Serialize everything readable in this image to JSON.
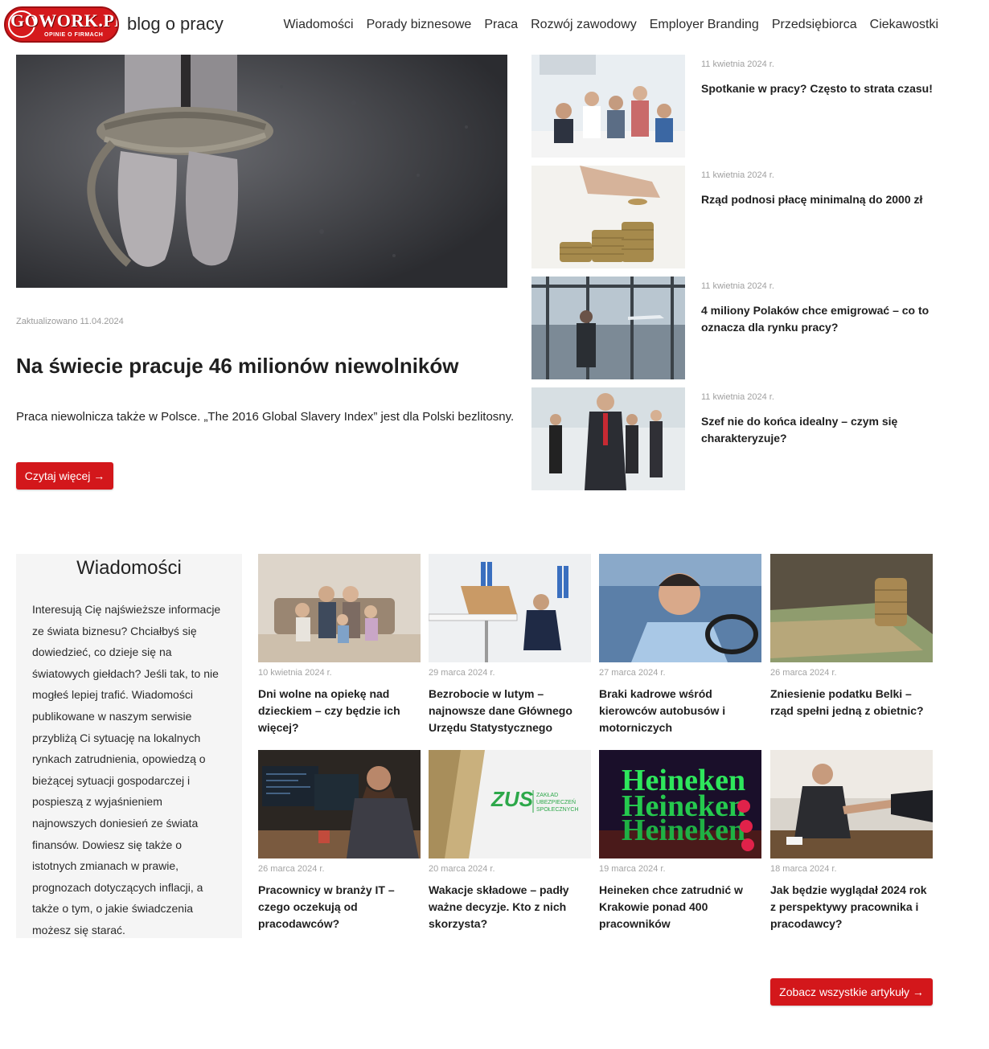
{
  "header": {
    "logo_text": "GOWORK.PL",
    "logo_sub": "OPINIE O FIRMACH",
    "brand": "blog o pracy",
    "nav": [
      "Wiadomości",
      "Porady biznesowe",
      "Praca",
      "Rozwój zawodowy",
      "Employer Branding",
      "Przedsiębiorca",
      "Ciekawostki"
    ]
  },
  "hero": {
    "updated": "Zaktualizowano 11.04.2024",
    "title": "Na świecie pracuje 46 milionów niewolników",
    "excerpt": "Praca niewolnicza także w Polsce. „The 2016 Global Slavery Index” jest dla Polski bezlitosny.",
    "button": "Czytaj więcej →"
  },
  "side_articles": [
    {
      "date": "11 kwietnia 2024 r.",
      "title": "Spotkanie w pracy? Często to strata czasu!"
    },
    {
      "date": "11 kwietnia 2024 r.",
      "title": "Rząd podnosi płacę minimalną do 2000 zł"
    },
    {
      "date": "11 kwietnia 2024 r.",
      "title": "4 miliony Polaków chce emigrować – co to oznacza dla rynku pracy?"
    },
    {
      "date": "11 kwietnia 2024 r.",
      "title": "Szef nie do końca idealny – czym się charakteryzuje?"
    }
  ],
  "section": {
    "title": "Wiadomości",
    "description": "Interesują Cię najświeższe informacje ze świata biznesu? Chciałbyś się dowiedzieć, co dzieje się na światowych giełdach? Jeśli tak, to nie mogłeś lepiej trafić. Wiadomości publikowane w naszym serwisie przybliżą Ci sytuację na lokalnych rynkach zatrudnienia, opowiedzą o bieżącej sytuacji gospodarczej i pospieszą z wyjaśnieniem najnowszych doniesień ze świata finansów. Dowiesz się także o istotnych zmianach w prawie, prognozach dotyczących inflacji, a także o tym, o jakie świadczenia możesz się starać."
  },
  "grid": [
    {
      "date": "10 kwietnia 2024 r.",
      "title": "Dni wolne na opiekę nad dzieckiem – czy będzie ich więcej?"
    },
    {
      "date": "29 marca 2024 r.",
      "title": "Bezrobocie w lutym – najnowsze dane Głównego Urzędu Statystycznego"
    },
    {
      "date": "27 marca 2024 r.",
      "title": "Braki kadrowe wśród kierowców autobusów i motorniczych"
    },
    {
      "date": "26 marca 2024 r.",
      "title": "Zniesienie podatku Belki – rząd spełni jedną z obietnic?"
    },
    {
      "date": "26 marca 2024 r.",
      "title": "Pracownicy w branży IT – czego oczekują od pracodawców?"
    },
    {
      "date": "20 marca 2024 r.",
      "title": "Wakacje składowe – padły ważne decyzje. Kto z nich skorzysta?"
    },
    {
      "date": "19 marca 2024 r.",
      "title": "Heineken chce zatrudnić w Krakowie ponad 400 pracowników"
    },
    {
      "date": "18 marca 2024 r.",
      "title": "Jak będzie wyglądał 2024 rok z perspektywy pracownika i pracodawcy?"
    }
  ],
  "image_text": {
    "zus_logo": "ZUS",
    "zus_sub1": "ZAKŁAD",
    "zus_sub2": "UBEZPIECZEŃ",
    "zus_sub3": "SPOŁECZNYCH",
    "heineken": "Heineken"
  },
  "all_articles_button": "Zobacz wszystkie artykuły →",
  "colors": {
    "accent": "#d3171b",
    "panel_bg": "#f5f5f5",
    "muted_text": "#a0a0a0"
  }
}
